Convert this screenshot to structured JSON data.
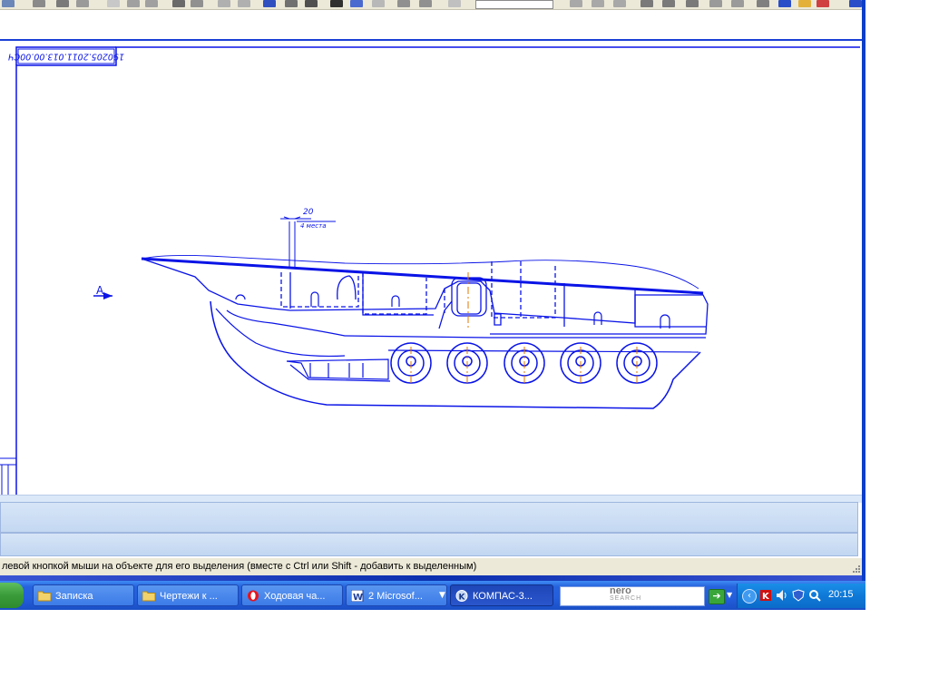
{
  "drawing": {
    "stamp_label": "190205.2011.013.00.00СЧ",
    "section_marker": "А",
    "dimension_value": "20",
    "dimension_note": "4 места",
    "line_color": "#0a14e6",
    "axis_color": "#e07a00"
  },
  "status_bar": {
    "message": "левой кнопкой мыши на объекте для его выделения (вместе с Ctrl или Shift - добавить к выделенным)"
  },
  "taskbar": {
    "items": [
      {
        "label": "Записка",
        "icon": "folder-icon"
      },
      {
        "label": "Чертежи к ...",
        "icon": "folder-icon"
      },
      {
        "label": "Ходовая ча...",
        "icon": "opera-icon"
      },
      {
        "label": "2 Microsof...",
        "icon": "word-icon"
      },
      {
        "label": "КОМПАС-3...",
        "icon": "kompas-icon"
      }
    ],
    "search_brand": "nero",
    "search_sub": "SEARCH",
    "clock": "20:15"
  }
}
